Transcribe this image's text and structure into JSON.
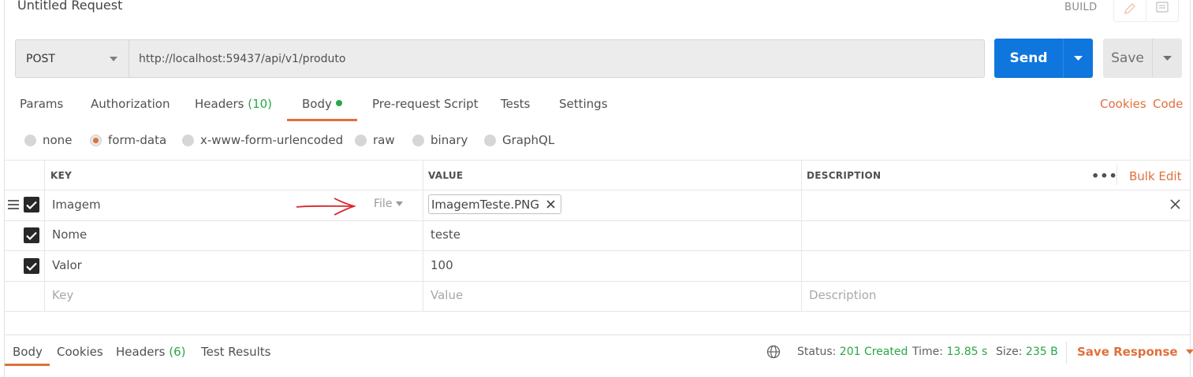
{
  "request": {
    "title": "Untitled Request",
    "build_label": "BUILD"
  },
  "url_bar": {
    "method": "POST",
    "url": "http://localhost:59437/api/v1/produto"
  },
  "buttons": {
    "send": "Send",
    "save": "Save"
  },
  "request_tabs": [
    {
      "label": "Params"
    },
    {
      "label": "Authorization"
    },
    {
      "label": "Headers",
      "count": "(10)"
    },
    {
      "label": "Body",
      "active": true,
      "has_dot": true
    },
    {
      "label": "Pre-request Script"
    },
    {
      "label": "Tests"
    },
    {
      "label": "Settings"
    }
  ],
  "right_links": {
    "cookies": "Cookies",
    "code": "Code"
  },
  "body_modes": [
    {
      "label": "none",
      "selected": false
    },
    {
      "label": "form-data",
      "selected": true
    },
    {
      "label": "x-www-form-urlencoded",
      "selected": false
    },
    {
      "label": "raw",
      "selected": false
    },
    {
      "label": "binary",
      "selected": false
    },
    {
      "label": "GraphQL",
      "selected": false
    }
  ],
  "form_table": {
    "headers": {
      "key": "KEY",
      "value": "VALUE",
      "description": "DESCRIPTION"
    },
    "bulk_edit": "Bulk Edit",
    "rows": [
      {
        "checked": true,
        "key": "Imagem",
        "type": "File",
        "value": "ImagemTeste.PNG",
        "description": ""
      },
      {
        "checked": true,
        "key": "Nome",
        "value": "teste",
        "description": ""
      },
      {
        "checked": true,
        "key": "Valor",
        "value": "100",
        "description": ""
      }
    ],
    "placeholders": {
      "key": "Key",
      "value": "Value",
      "description": "Description"
    }
  },
  "response": {
    "tabs": [
      {
        "label": "Body",
        "active": true
      },
      {
        "label": "Cookies"
      },
      {
        "label": "Headers",
        "count": "(6)"
      },
      {
        "label": "Test Results"
      }
    ],
    "status_label": "Status:",
    "status_value": "201 Created",
    "time_label": "Time:",
    "time_value": "13.85 s",
    "size_label": "Size:",
    "size_value": "235 B",
    "save_response": "Save Response"
  },
  "colors": {
    "accent": "#e0703d",
    "send_blue": "#0f76de",
    "success_green": "#28a745",
    "annotation_red": "#d9262c"
  }
}
